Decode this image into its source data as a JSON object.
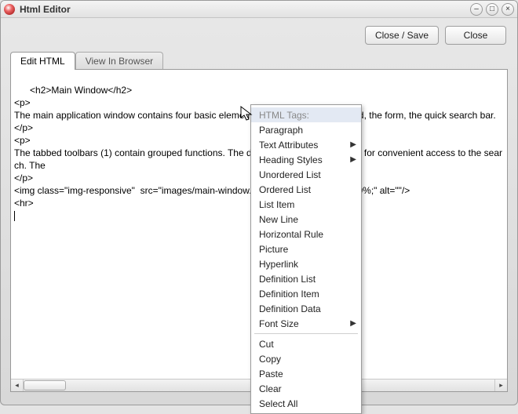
{
  "window": {
    "title": "Html Editor"
  },
  "toolbar": {
    "close_save": "Close / Save",
    "close": "Close"
  },
  "tabs": {
    "edit": "Edit HTML",
    "view": "View In Browser"
  },
  "editor": {
    "content": "<h2>Main Window</h2>\n<p>\nThe main application window contains four basic elements: tabbed toolbars, the grid, the form, the quick search bar.\n</p>\n<p>\nThe tabbed toolbars (1) contain grouped functions. The default tab opened is \"Find\" for convenient access to the search. The\n</p>\n<img class=\"img-responsive\"  src=\"images/main-window.png\" style=\"max-width:100%;\" alt=\"\"/>\n<hr>"
  },
  "context_menu": {
    "header": "HTML Tags:",
    "items_group1": [
      {
        "label": "Paragraph",
        "submenu": false
      },
      {
        "label": "Text Attributes",
        "submenu": true
      },
      {
        "label": "Heading Styles",
        "submenu": true
      },
      {
        "label": "Unordered List",
        "submenu": false
      },
      {
        "label": "Ordered List",
        "submenu": false
      },
      {
        "label": "List Item",
        "submenu": false
      },
      {
        "label": "New Line",
        "submenu": false
      },
      {
        "label": "Horizontal Rule",
        "submenu": false
      },
      {
        "label": "Picture",
        "submenu": false
      },
      {
        "label": "Hyperlink",
        "submenu": false
      },
      {
        "label": "Definition List",
        "submenu": false
      },
      {
        "label": "Definition Item",
        "submenu": false
      },
      {
        "label": "Definition Data",
        "submenu": false
      },
      {
        "label": "Font Size",
        "submenu": true
      }
    ],
    "items_group2": [
      {
        "label": "Cut"
      },
      {
        "label": "Copy"
      },
      {
        "label": "Paste"
      },
      {
        "label": "Clear"
      },
      {
        "label": "Select All"
      }
    ]
  }
}
